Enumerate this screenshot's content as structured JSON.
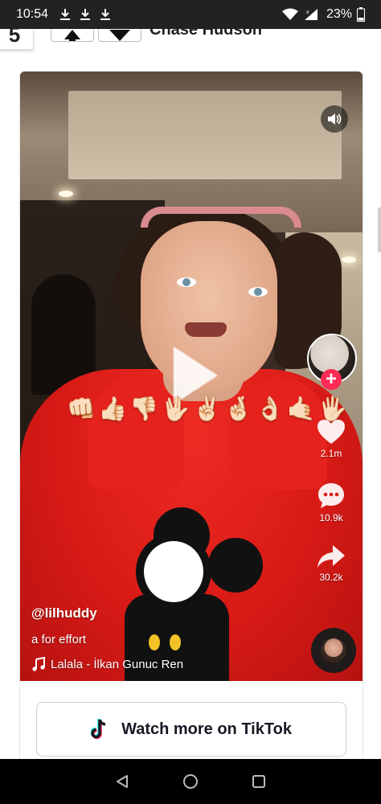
{
  "status_bar": {
    "time": "10:54",
    "battery": "23%",
    "icons": [
      "download-icon",
      "download-icon",
      "download-icon",
      "wifi-icon",
      "signal-icon",
      "battery-icon"
    ]
  },
  "page": {
    "rank_number": "5",
    "title": "Chase Hudson"
  },
  "tiktok": {
    "username": "@lilhuddy",
    "description": "a for effort",
    "music": "Lalala - İlkan Gunuc Ren",
    "emoji_overlay": [
      "👊🏻",
      "👍🏻",
      "👎🏻",
      "🖖🏻",
      "✌🏻",
      "🤞🏻",
      "👌🏻",
      "🤙🏻",
      "🖐🏻"
    ],
    "likes": "2.1m",
    "comments": "10.9k",
    "shares": "30.2k",
    "follow_symbol": "+",
    "accent_color": "#fe2c55"
  },
  "cta": {
    "watch_more_label": "Watch more on TikTok"
  }
}
